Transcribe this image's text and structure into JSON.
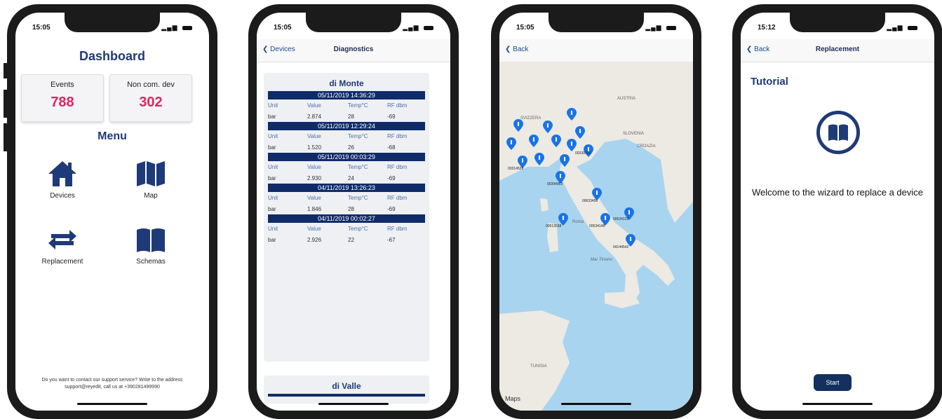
{
  "screens": {
    "dashboard": {
      "time": "15:05",
      "title": "Dashboard",
      "cards": [
        {
          "label": "Events",
          "value": "788"
        },
        {
          "label": "Non com. dev",
          "value": "302"
        }
      ],
      "menu_title": "Menu",
      "menu_items": [
        {
          "label": "Devices",
          "icon": "home-icon"
        },
        {
          "label": "Map",
          "icon": "map-icon"
        },
        {
          "label": "Replacement",
          "icon": "swap-arrows-icon"
        },
        {
          "label": "Schemas",
          "icon": "book-icon"
        }
      ],
      "footer": "Do you want to contact our support service? Write to the address support@reyedit, call us at +390281499990"
    },
    "diagnostics": {
      "time": "15:05",
      "back_label": "Devices",
      "title": "Diagnostics",
      "panel_title": "di Monte",
      "columns": [
        "Unit",
        "Value",
        "Temp°C",
        "RF dbm"
      ],
      "entries": [
        {
          "date": "05/11/2019 14:36:29",
          "unit": "bar",
          "value": "2.874",
          "temp": "28",
          "rf": "-69"
        },
        {
          "date": "05/11/2019 12:29:24",
          "unit": "bar",
          "value": "1.520",
          "temp": "26",
          "rf": "-68"
        },
        {
          "date": "05/11/2019 00:03:29",
          "unit": "bar",
          "value": "2.930",
          "temp": "24",
          "rf": "-69"
        },
        {
          "date": "04/11/2019 13:26:23",
          "unit": "bar",
          "value": "1.846",
          "temp": "28",
          "rf": "-69"
        },
        {
          "date": "04/11/2019 00:02:27",
          "unit": "bar",
          "value": "2.926",
          "temp": "22",
          "rf": "-67"
        }
      ],
      "panel2_title": "di Valle"
    },
    "map": {
      "time": "15:05",
      "back_label": "Back",
      "labels": [
        "SVIZZERA",
        "AUSTRIA",
        "SLOVENIA",
        "CROAZIA",
        "Roma",
        "Mar Tirreno",
        "TUNISIA",
        "Maps"
      ],
      "pin_labels": [
        "00339720",
        "00314528",
        "00394963",
        "00633456",
        "00613538",
        "00534148",
        "00534129",
        "04144542"
      ]
    },
    "replacement": {
      "time": "15:12",
      "back_label": "Back",
      "title": "Replacement",
      "tutorial": "Tutorial",
      "welcome": "Welcome to the wizard to replace a device",
      "start_label": "Start"
    }
  },
  "colors": {
    "brand": "#1f3a78",
    "accent": "#e0245e",
    "dark_bar": "#0f2b69",
    "pin": "#1a73e8"
  }
}
